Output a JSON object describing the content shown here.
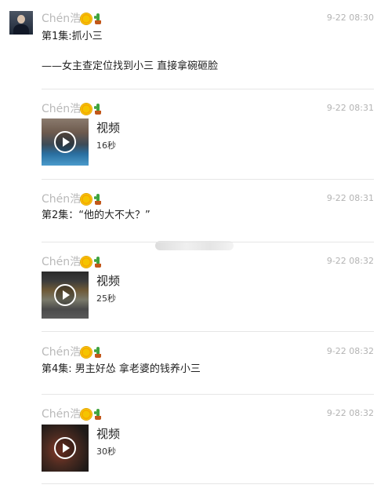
{
  "sender": {
    "name": "Chén浩",
    "icons": [
      "sun-icon",
      "cactus-icon"
    ]
  },
  "messages": [
    {
      "time": "9-22 08:30",
      "text": "第1集:抓小三",
      "text2": "——女主查定位找到小三 直接拿碗砸脸"
    },
    {
      "time": "9-22 08:31",
      "video_label": "视频",
      "duration": "16秒"
    },
    {
      "time": "9-22 08:31",
      "text": "第2集：“他的大不大？”"
    },
    {
      "time": "9-22 08:32",
      "video_label": "视频",
      "duration": "25秒"
    },
    {
      "time": "9-22 08:32",
      "text": "第4集: 男主好怂 拿老婆的钱养小三"
    },
    {
      "time": "9-22 08:32",
      "video_label": "视频",
      "duration": "30秒"
    }
  ]
}
